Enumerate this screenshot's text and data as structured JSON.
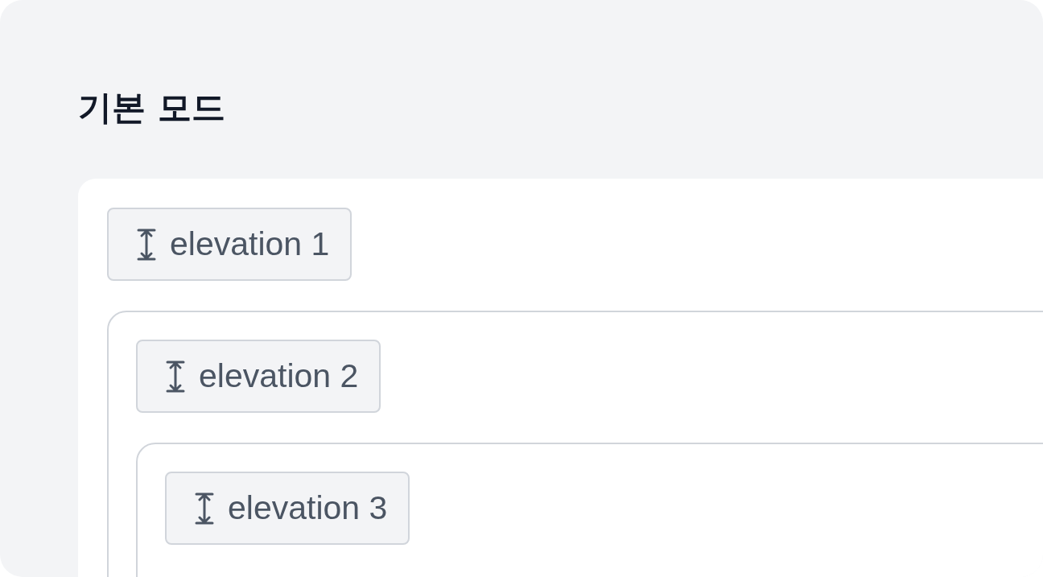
{
  "title": "기본 모드",
  "levels": [
    {
      "label": "elevation 1",
      "children": [
        {
          "label": "elevation 2",
          "children": [
            {
              "label": "elevation 3"
            }
          ]
        }
      ]
    }
  ]
}
